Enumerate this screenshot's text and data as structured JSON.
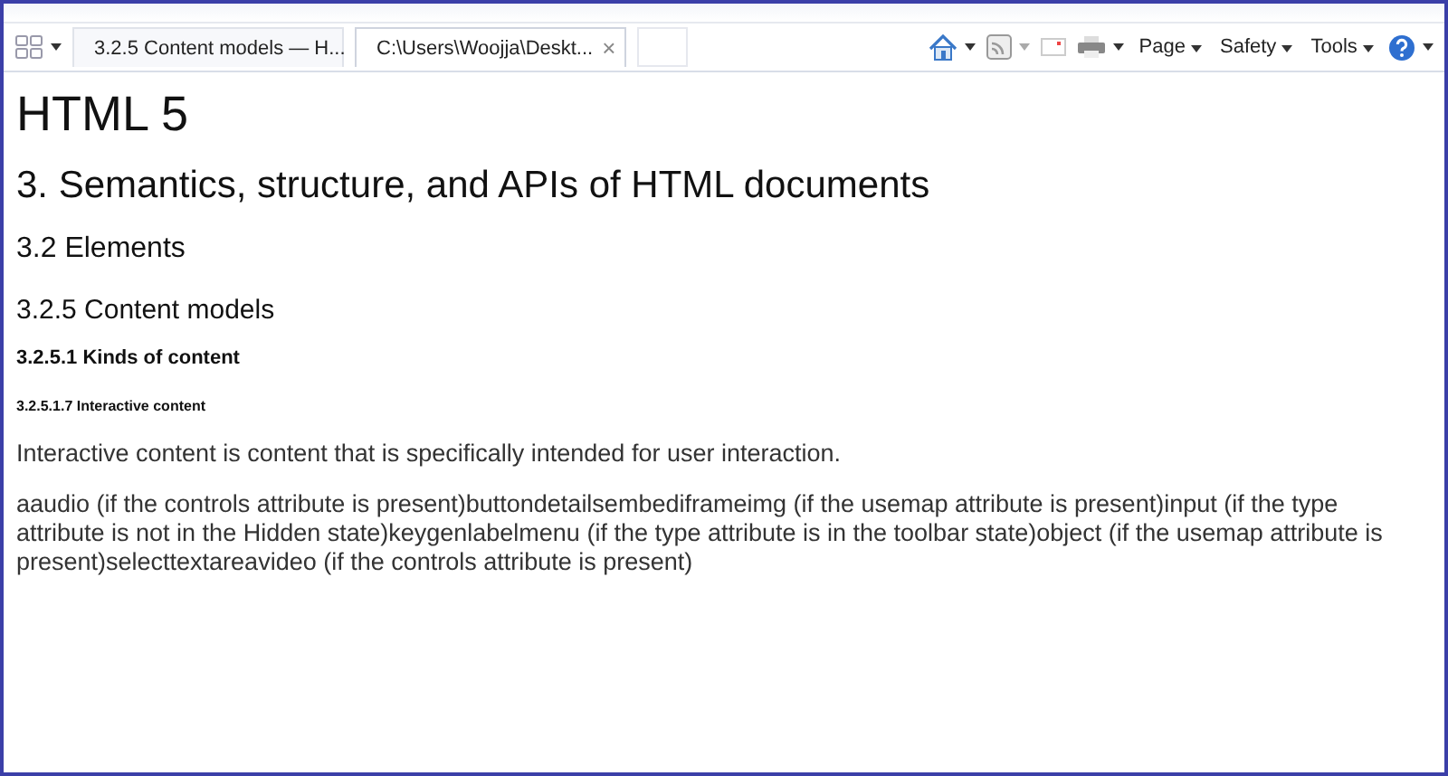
{
  "tabs": [
    {
      "label": "3.2.5 Content models — H...",
      "selected": false
    },
    {
      "label": "C:\\Users\\Woojja\\Deskt...",
      "selected": true,
      "close": "×"
    }
  ],
  "toolbar": {
    "menus": [
      "Page",
      "Safety",
      "Tools"
    ]
  },
  "document": {
    "h1": "HTML 5",
    "h2": "3. Semantics, structure, and APIs of HTML documents",
    "h3": "3.2 Elements",
    "h4": "3.2.5 Content models",
    "h5": "3.2.5.1 Kinds of content",
    "h6": "3.2.5.1.7 Interactive content",
    "paragraphs": [
      "Interactive content is content that is specifically intended for user interaction.",
      "aaudio (if the controls attribute is present)buttondetailsembediframeimg (if the usemap attribute is present)input (if the type attribute is not in the Hidden state)keygenlabelmenu (if the type attribute is in the toolbar state)object (if the usemap attribute is present)selecttextareavideo (if the controls attribute is present)"
    ]
  }
}
